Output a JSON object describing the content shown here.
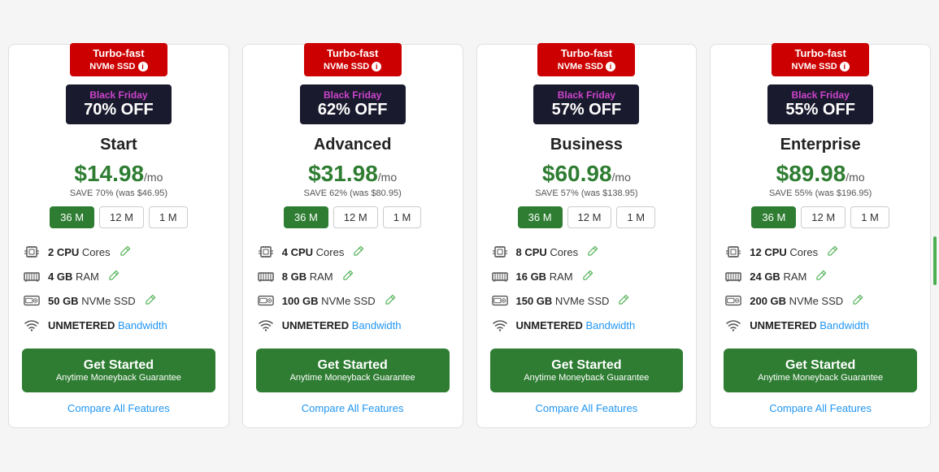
{
  "plans": [
    {
      "id": "start",
      "turbo_line1": "Turbo-fast",
      "turbo_line2": "NVMe SSD",
      "bf_label": "Black Friday",
      "discount": "70% OFF",
      "name": "Start",
      "price": "$14.98",
      "per_mo": "/mo",
      "savings": "SAVE 70% (was $46.95)",
      "periods": [
        "36 M",
        "12 M",
        "1 M"
      ],
      "active_period": 0,
      "features": [
        {
          "type": "cpu",
          "text": "2 CPU Cores",
          "bold": "2 CPU"
        },
        {
          "type": "ram",
          "text": "4 GB RAM",
          "bold": "4 GB"
        },
        {
          "type": "ssd",
          "text": "50 GB NVMe SSD",
          "bold": "50 GB"
        },
        {
          "type": "bandwidth",
          "text": "UNMETERED Bandwidth",
          "bold": "UNMETERED"
        }
      ],
      "cta_line1": "Get Started",
      "cta_line2": "Anytime Moneyback Guarantee",
      "compare_label": "Compare All Features"
    },
    {
      "id": "advanced",
      "turbo_line1": "Turbo-fast",
      "turbo_line2": "NVMe SSD",
      "bf_label": "Black Friday",
      "discount": "62% OFF",
      "name": "Advanced",
      "price": "$31.98",
      "per_mo": "/mo",
      "savings": "SAVE 62% (was $80.95)",
      "periods": [
        "36 M",
        "12 M",
        "1 M"
      ],
      "active_period": 0,
      "features": [
        {
          "type": "cpu",
          "text": "4 CPU Cores",
          "bold": "4 CPU"
        },
        {
          "type": "ram",
          "text": "8 GB RAM",
          "bold": "8 GB"
        },
        {
          "type": "ssd",
          "text": "100 GB NVMe SSD",
          "bold": "100 GB"
        },
        {
          "type": "bandwidth",
          "text": "UNMETERED Bandwidth",
          "bold": "UNMETERED"
        }
      ],
      "cta_line1": "Get Started",
      "cta_line2": "Anytime Moneyback Guarantee",
      "compare_label": "Compare All Features"
    },
    {
      "id": "business",
      "turbo_line1": "Turbo-fast",
      "turbo_line2": "NVMe SSD",
      "bf_label": "Black Friday",
      "discount": "57% OFF",
      "name": "Business",
      "price": "$60.98",
      "per_mo": "/mo",
      "savings": "SAVE 57% (was $138.95)",
      "periods": [
        "36 M",
        "12 M",
        "1 M"
      ],
      "active_period": 0,
      "features": [
        {
          "type": "cpu",
          "text": "8 CPU Cores",
          "bold": "8 CPU"
        },
        {
          "type": "ram",
          "text": "16 GB RAM",
          "bold": "16 GB"
        },
        {
          "type": "ssd",
          "text": "150 GB NVMe SSD",
          "bold": "150 GB"
        },
        {
          "type": "bandwidth",
          "text": "UNMETERED Bandwidth",
          "bold": "UNMETERED"
        }
      ],
      "cta_line1": "Get Started",
      "cta_line2": "Anytime Moneyback Guarantee",
      "compare_label": "Compare All Features"
    },
    {
      "id": "enterprise",
      "turbo_line1": "Turbo-fast",
      "turbo_line2": "NVMe SSD",
      "bf_label": "Black Friday",
      "discount": "55% OFF",
      "name": "Enterprise",
      "price": "$89.98",
      "per_mo": "/mo",
      "savings": "SAVE 55% (was $196.95)",
      "periods": [
        "36 M",
        "12 M",
        "1 M"
      ],
      "active_period": 0,
      "features": [
        {
          "type": "cpu",
          "text": "12 CPU Cores",
          "bold": "12 CPU"
        },
        {
          "type": "ram",
          "text": "24 GB RAM",
          "bold": "24 GB"
        },
        {
          "type": "ssd",
          "text": "200 GB NVMe SSD",
          "bold": "200 GB"
        },
        {
          "type": "bandwidth",
          "text": "UNMETERED Bandwidth",
          "bold": "UNMETERED"
        }
      ],
      "cta_line1": "Get Started",
      "cta_line2": "Anytime Moneyback Guarantee",
      "compare_label": "Compare All Features"
    }
  ]
}
